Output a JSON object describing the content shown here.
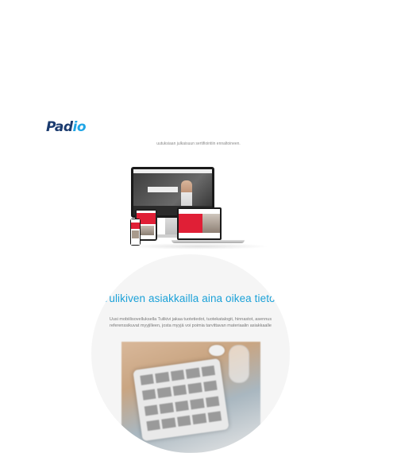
{
  "brand": {
    "logo_part1": "Pad",
    "logo_part2": "io"
  },
  "hero": {
    "caption": "uutuksiaan julkaisuun sertifiointiin ennaltoineen."
  },
  "feature": {
    "headline": "Tulikiven asiakkailla aina oikea tieto.",
    "description_line1": "Uusi mobiilisovelluksella Tulikivi jakaa tuotetiedot, tuotekatalogit, hinnastot, asennus",
    "description_line2": "referenssikuvat myyjilleen, josta myyjä voi poimia tarvittavan materiaalin asiakkaalle"
  },
  "colors": {
    "brand_dark": "#1b3b6f",
    "brand_light": "#1fa5e6",
    "headline": "#1ba1d8",
    "accent_red": "#e01f36"
  }
}
